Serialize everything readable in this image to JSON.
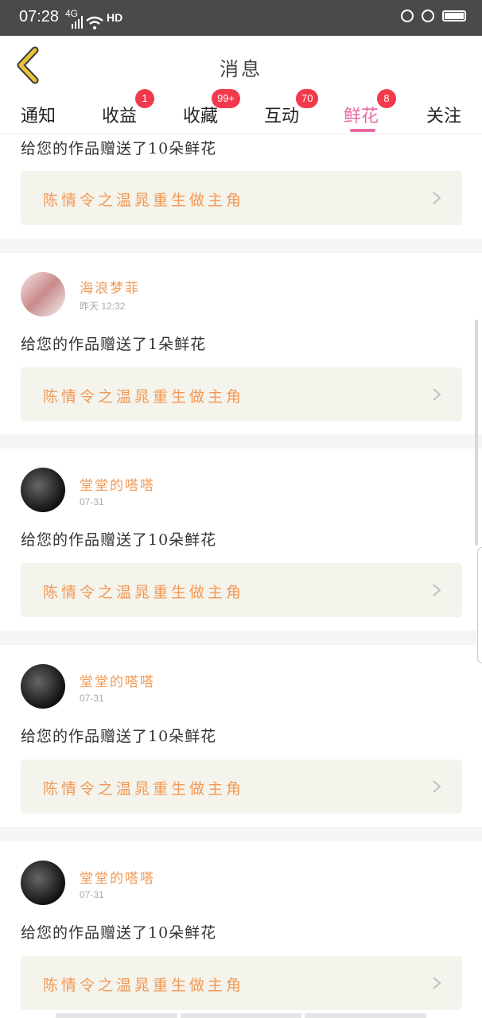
{
  "status_bar": {
    "time": "07:28",
    "network": "4G",
    "hd": "HD",
    "icons": [
      "signal-icon",
      "wifi-icon",
      "lock-rotation-icon",
      "alarm-icon",
      "battery-icon"
    ]
  },
  "header": {
    "title": "消息",
    "back_icon": "chevron-left-icon"
  },
  "tabs": [
    {
      "label": "通知",
      "badge": ""
    },
    {
      "label": "收益",
      "badge": "1"
    },
    {
      "label": "收藏",
      "badge": "99+"
    },
    {
      "label": "互动",
      "badge": "70"
    },
    {
      "label": "鲜花",
      "badge": "8",
      "active": true
    },
    {
      "label": "关注",
      "badge": ""
    }
  ],
  "items": [
    {
      "gift_text": "给您的作品赠送了10朵鲜花",
      "work_title": "陈情令之温晁重生做主角"
    },
    {
      "user": "海浪梦菲",
      "time": "昨天 12:32",
      "gift_text": "给您的作品赠送了1朵鲜花",
      "work_title": "陈情令之温晁重生做主角"
    },
    {
      "user": "堂堂的嗒嗒",
      "time": "07-31",
      "gift_text": "给您的作品赠送了10朵鲜花",
      "work_title": "陈情令之温晁重生做主角"
    },
    {
      "user": "堂堂的嗒嗒",
      "time": "07-31",
      "gift_text": "给您的作品赠送了10朵鲜花",
      "work_title": "陈情令之温晁重生做主角"
    },
    {
      "user": "堂堂的嗒嗒",
      "time": "07-31",
      "gift_text": "给您的作品赠送了10朵鲜花",
      "work_title": "陈情令之温晁重生做主角"
    }
  ],
  "colors": {
    "accent": "#e86aa3",
    "badge": "#f23a4c",
    "username": "#f19a55",
    "work_bg": "#f4f3ec",
    "back_arrow": "#e8c23a"
  }
}
